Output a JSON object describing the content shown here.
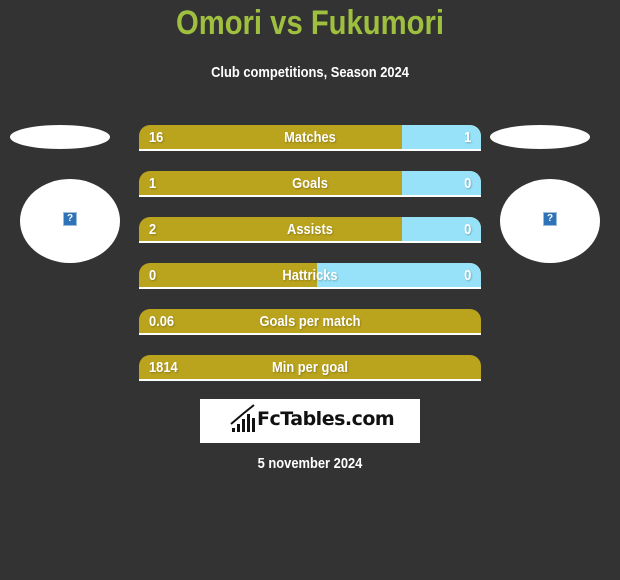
{
  "header": {
    "title": "Omori vs Fukumori",
    "subtitle": "Club competitions, Season 2024"
  },
  "players": {
    "left": {
      "name": "Omori",
      "avatar_icon": "missing-image-icon"
    },
    "right": {
      "name": "Fukumori",
      "avatar_icon": "missing-image-icon"
    }
  },
  "colors": {
    "background": "#333333",
    "title": "#9fbf3f",
    "left_bar": "#bba41d",
    "right_bar": "#97e2f8"
  },
  "stats": [
    {
      "label": "Matches",
      "left": "16",
      "right": "1",
      "left_fill": 0.77
    },
    {
      "label": "Goals",
      "left": "1",
      "right": "0",
      "left_fill": 0.77
    },
    {
      "label": "Assists",
      "left": "2",
      "right": "0",
      "left_fill": 0.77
    },
    {
      "label": "Hattricks",
      "left": "0",
      "right": "0",
      "left_fill": 0.52
    },
    {
      "label": "Goals per match",
      "left": "0.06",
      "right": "",
      "left_fill": 1.0
    },
    {
      "label": "Min per goal",
      "left": "1814",
      "right": "",
      "left_fill": 1.0
    }
  ],
  "footer": {
    "logo_text": "FcTables.com",
    "date": "5 november 2024"
  }
}
